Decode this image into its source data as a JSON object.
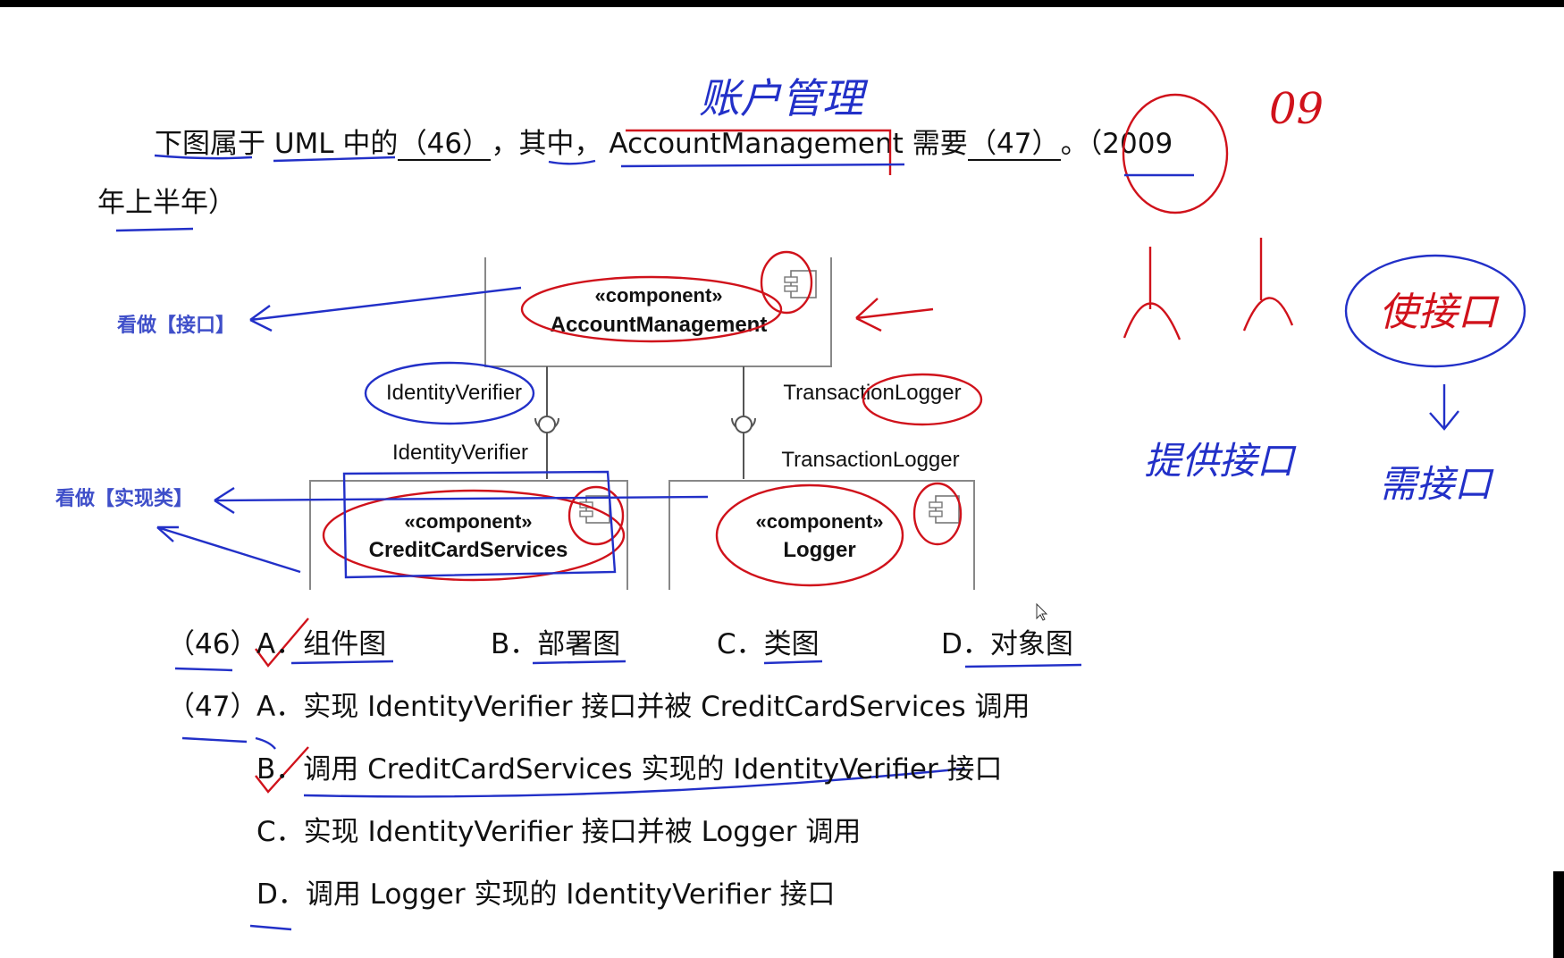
{
  "question": {
    "seg1": "下图属于 UML 中的",
    "blank46": "（46）",
    "seg2": "，其中，",
    "class_name": "AccountManagement",
    "seg3": "需要",
    "blank47": "（47）",
    "seg4": "。（",
    "year": "2009",
    "line2": "年上半年）"
  },
  "diagram": {
    "top_component": {
      "stereotype": "«component»",
      "name": "AccountManagement"
    },
    "left_component": {
      "stereotype": "«component»",
      "name": "CreditCardServices"
    },
    "right_component": {
      "stereotype": "«component»",
      "name": "Logger"
    },
    "left_interface_required": "IdentityVerifier",
    "left_interface_provided": "IdentityVerifier",
    "right_interface_required": "TransactionLogger",
    "right_interface_provided": "TransactionLogger"
  },
  "notes": {
    "as_interface": "看做【接口】",
    "as_impl_class": "看做【实现类】"
  },
  "handwriting": {
    "above_class": "账户管理",
    "year_short": "09",
    "provide_interface": "提供接口",
    "use_interface": "使接口",
    "need_interface": "需接口"
  },
  "q46": {
    "num": "（46）",
    "options": [
      {
        "key": "A．",
        "text": "组件图"
      },
      {
        "key": "B．",
        "text": "部署图"
      },
      {
        "key": "C．",
        "text": "类图"
      },
      {
        "key": "D．",
        "text": "对象图"
      }
    ]
  },
  "q47": {
    "num": "（47）",
    "options": [
      {
        "key": "A．",
        "text": "实现 IdentityVerifier 接口并被 CreditCardServices 调用"
      },
      {
        "key": "B．",
        "text": "调用 CreditCardServices 实现的 IdentityVerifier 接口"
      },
      {
        "key": "C．",
        "text": "实现 IdentityVerifier 接口并被 Logger 调用"
      },
      {
        "key": "D．",
        "text": "调用 Logger 实现的 IdentityVerifier 接口"
      }
    ]
  },
  "colors": {
    "red_ink": "#d0121b",
    "blue_ink": "#2230c8",
    "note_blue": "#3f4fc9"
  }
}
